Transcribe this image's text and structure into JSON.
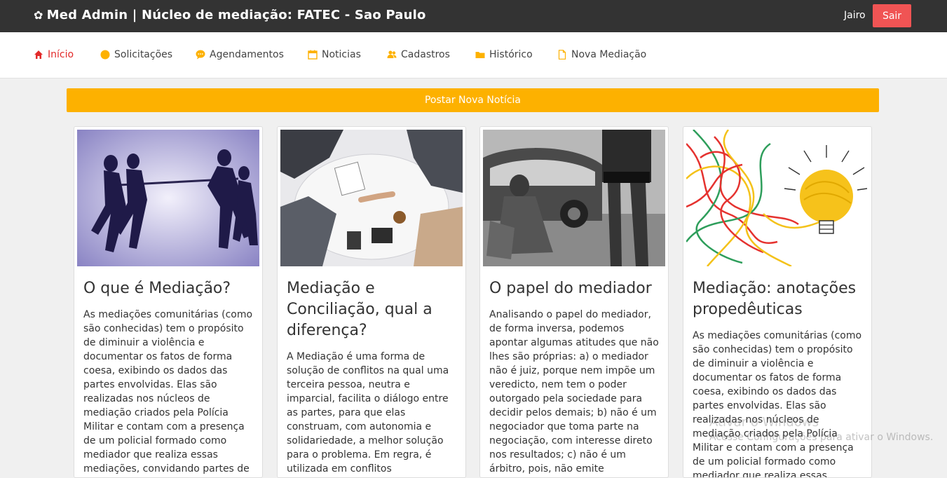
{
  "header": {
    "brand": "Med Admin | Núcleo de mediação: FATEC - Sao Paulo",
    "brand_icon": "gear-icon",
    "user": "Jairo",
    "logout_label": "Sair",
    "logout_color": "#f05454",
    "bar_color": "#333333"
  },
  "nav": {
    "items": [
      {
        "label": "Início",
        "icon": "home-icon",
        "active": true
      },
      {
        "label": "Solicitações",
        "icon": "circle-icon"
      },
      {
        "label": "Agendamentos",
        "icon": "chat-icon"
      },
      {
        "label": "Noticias",
        "icon": "calendar-icon"
      },
      {
        "label": "Cadastros",
        "icon": "users-icon"
      },
      {
        "label": "Histórico",
        "icon": "folder-icon"
      },
      {
        "label": "Nova Mediação",
        "icon": "file-icon"
      }
    ],
    "active_color": "#e22a2a",
    "icon_color": "#fdb100"
  },
  "post_button": {
    "label": "Postar Nova Notícia",
    "color": "#fdb100"
  },
  "cards": [
    {
      "title": "O que é Mediação?",
      "text": "As mediações comunitárias (como são conhecidas) tem o propósito de diminuir a violência e documentar os fatos de forma coesa, exibindo os dados das partes envolvidas. Elas são realizadas nos núcleos de mediação criados pela Polícia Militar e contam com a presença de um policial formado como mediador que realiza essas mediações, convidando partes de um conflito,"
    },
    {
      "title": "Mediação e Conciliação, qual a diferença?",
      "text": "A Mediação é uma forma de solução de conflitos na qual uma terceira pessoa, neutra e imparcial, facilita o diálogo entre as partes, para que elas construam, com autonomia e solidariedade, a melhor solução para o problema. Em regra, é utilizada em conflitos"
    },
    {
      "title": "O papel do mediador",
      "text": "Analisando o papel do mediador, de forma inversa, podemos apontar algumas atitudes que não lhes são próprias: a) o mediador não é juiz, porque nem impõe um veredicto, nem tem o poder outorgado pela sociedade para decidir pelos demais; b) não é um negociador que toma parte na negociação, com interesse direto nos resultados; c) não é um árbitro, pois, não emite"
    },
    {
      "title": "Mediação: anotações propedêuticas",
      "text": "As mediações comunitárias (como são conhecidas) tem o propósito de diminuir a violência e documentar os fatos de forma coesa, exibindo os dados das partes envolvidas. Elas são realizadas nos núcleos de mediação criados pela Polícia Militar e contam com a presença de um policial formado como mediador que realiza essas mediações,"
    }
  ],
  "watermark": {
    "line1": "Ativar o Windows",
    "line2": "Acesse Configurações para ativar o Windows."
  }
}
